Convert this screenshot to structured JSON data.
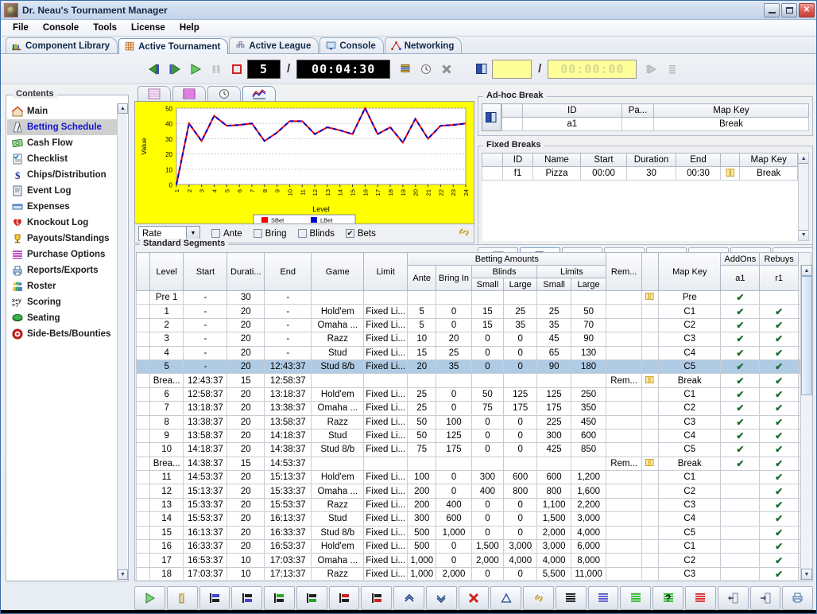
{
  "window": {
    "title": "Dr. Neau's Tournament Manager",
    "minimize_label": "Minimize",
    "maximize_label": "Maximize",
    "close_label": "✕"
  },
  "menu": [
    "File",
    "Console",
    "Tools",
    "License",
    "Help"
  ],
  "main_tabs": [
    {
      "label": "Component Library",
      "icon": "books-icon",
      "active": false
    },
    {
      "label": "Active Tournament",
      "icon": "grid-icon",
      "active": true
    },
    {
      "label": "Active League",
      "icon": "pyramid-icon",
      "active": false
    },
    {
      "label": "Console",
      "icon": "monitor-icon",
      "active": false
    },
    {
      "label": "Networking",
      "icon": "network-icon",
      "active": false
    }
  ],
  "transport": {
    "buttons": [
      "skip-to-start-icon",
      "step-forward-icon",
      "play-icon",
      "pause-icon",
      "stop-icon"
    ],
    "level_current": "5",
    "slash": "/",
    "clock": "00:04:30",
    "right_buttons": [
      "layers-icon",
      "clock-icon",
      "cancel-icon"
    ],
    "break_icon": "book-icon",
    "break_level": "",
    "break_clock": "00:00:00",
    "trailing_buttons": [
      "play-disabled-icon",
      "list-disabled-icon"
    ]
  },
  "sidebar": {
    "title": "Contents",
    "items": [
      {
        "label": "Main",
        "icon": "home-icon"
      },
      {
        "label": "Betting Schedule",
        "icon": "metronome-icon",
        "selected": true
      },
      {
        "label": "Cash Flow",
        "icon": "money-icon"
      },
      {
        "label": "Checklist",
        "icon": "checklist-icon"
      },
      {
        "label": "Chips/Distribution",
        "icon": "dollar-icon"
      },
      {
        "label": "Event Log",
        "icon": "log-icon"
      },
      {
        "label": "Expenses",
        "icon": "expenses-icon"
      },
      {
        "label": "Knockout Log",
        "icon": "broken-heart-icon"
      },
      {
        "label": "Payouts/Standings",
        "icon": "trophy-icon"
      },
      {
        "label": "Purchase Options",
        "icon": "stack-icon"
      },
      {
        "label": "Reports/Exports",
        "icon": "printer-icon"
      },
      {
        "label": "Roster",
        "icon": "people-icon"
      },
      {
        "label": "Scoring",
        "icon": "formula-icon"
      },
      {
        "label": "Seating",
        "icon": "table-icon"
      },
      {
        "label": "Side-Bets/Bounties",
        "icon": "target-icon"
      }
    ]
  },
  "chart_tabs": [
    {
      "icon": "table-pink-icon",
      "active": false
    },
    {
      "icon": "table-magenta-icon",
      "active": false
    },
    {
      "icon": "clock-icon",
      "active": false
    },
    {
      "icon": "chart-icon",
      "active": true
    }
  ],
  "chart_options": {
    "mode": "Rate",
    "checkboxes": [
      {
        "label": "Ante",
        "checked": false
      },
      {
        "label": "Bring",
        "checked": false
      },
      {
        "label": "Blinds",
        "checked": false
      },
      {
        "label": "Bets",
        "checked": true
      }
    ],
    "link_icon": "chain-icon"
  },
  "chart_data": {
    "type": "line",
    "title": "",
    "xlabel": "Level",
    "ylabel": "Value",
    "background": "#ffff00",
    "plot_background": "#ffffff",
    "grid": true,
    "legend_position": "bottom",
    "xlim": [
      1,
      24
    ],
    "ylim": [
      0,
      50
    ],
    "yticks": [
      0,
      10,
      20,
      30,
      40,
      50
    ],
    "categories": [
      1,
      2,
      3,
      4,
      5,
      6,
      7,
      8,
      9,
      10,
      11,
      12,
      13,
      14,
      15,
      16,
      17,
      18,
      19,
      20,
      21,
      22,
      23,
      24
    ],
    "series": [
      {
        "name": "SBet",
        "color": "#ff0000",
        "values": [
          0,
          40,
          28.5,
          45,
          38.5,
          39,
          40,
          28.5,
          34,
          41.5,
          41.5,
          33,
          37.5,
          35.5,
          33,
          50,
          33,
          37.5,
          27.5,
          43,
          30,
          38.5,
          39,
          40
        ]
      },
      {
        "name": "LBet",
        "color": "#0000cc",
        "values": [
          0,
          40,
          28.5,
          45,
          38.5,
          39,
          40,
          28.5,
          34,
          41.5,
          41.5,
          33,
          37.5,
          35.5,
          33,
          50,
          33,
          37.5,
          27.5,
          43,
          30,
          38.5,
          39,
          40
        ]
      }
    ]
  },
  "adhoc": {
    "title": "Ad-hoc Break",
    "icon": "book-icon",
    "headers": [
      "",
      "",
      "ID",
      "Pa...",
      "Map Key"
    ],
    "rows": [
      {
        "id": "a1",
        "pa": "",
        "map_key": "Break"
      }
    ]
  },
  "fixed_breaks": {
    "title": "Fixed Breaks",
    "headers": [
      "",
      "ID",
      "Name",
      "Start",
      "Duration",
      "End",
      "",
      "Map Key"
    ],
    "rows": [
      {
        "id": "f1",
        "name": "Pizza",
        "start": "00:00",
        "duration": "30",
        "end": "00:30",
        "flag": "pause-icon",
        "map_key": "Break"
      }
    ],
    "toolbar": [
      "book-disabled-icon",
      "new-doc-icon",
      "triangle-disabled-icon",
      "delete-disabled-icon",
      "red-lines-icon",
      "clock-disabled-icon",
      "percent-disabled-icon",
      "undo-disabled-icon"
    ]
  },
  "segments": {
    "title": "Standard Segments",
    "group_headers": {
      "betting": "Betting Amounts",
      "blinds": "Blinds",
      "limits": "Limits",
      "addons": "AddOns",
      "rebuys": "Rebuys"
    },
    "headers": [
      "",
      "Level",
      "Start",
      "Durati...",
      "End",
      "Game",
      "Limit",
      "Ante",
      "Bring In",
      "Small",
      "Large",
      "Small",
      "Large",
      "Rem...",
      "",
      "Map Key",
      "a1",
      "r1"
    ],
    "rows": [
      {
        "marker": "dark",
        "level": "Pre 1",
        "start": "-",
        "duration": "30",
        "end": "-",
        "game": "",
        "limit": "",
        "ante": "",
        "bring_in": "",
        "bs": "",
        "bl": "",
        "ls": "",
        "ll": "",
        "rem": "",
        "flag": "pause-icon",
        "map_key": "Pre",
        "addon": true,
        "rebuy": false,
        "shaded": true
      },
      {
        "marker": "dark",
        "level": "1",
        "start": "-",
        "duration": "20",
        "end": "-",
        "game": "Hold'em",
        "limit": "Fixed Li...",
        "ante": "5",
        "bring_in": "0",
        "bs": "15",
        "bl": "25",
        "ls": "25",
        "ll": "50",
        "rem": "",
        "flag": "",
        "map_key": "C1",
        "addon": true,
        "rebuy": true,
        "shaded": true
      },
      {
        "marker": "dark",
        "level": "2",
        "start": "-",
        "duration": "20",
        "end": "-",
        "game": "Omaha ...",
        "limit": "Fixed Li...",
        "ante": "5",
        "bring_in": "0",
        "bs": "15",
        "bl": "35",
        "ls": "35",
        "ll": "70",
        "rem": "",
        "flag": "",
        "map_key": "C2",
        "addon": true,
        "rebuy": true,
        "shaded": true
      },
      {
        "marker": "dark",
        "level": "3",
        "start": "-",
        "duration": "20",
        "end": "-",
        "game": "Razz",
        "limit": "Fixed Li...",
        "ante": "10",
        "bring_in": "20",
        "bs": "0",
        "bl": "0",
        "ls": "45",
        "ll": "90",
        "rem": "",
        "flag": "",
        "map_key": "C3",
        "addon": true,
        "rebuy": true,
        "shaded": true
      },
      {
        "marker": "dark",
        "level": "4",
        "start": "-",
        "duration": "20",
        "end": "-",
        "game": "Stud",
        "limit": "Fixed Li...",
        "ante": "15",
        "bring_in": "25",
        "bs": "0",
        "bl": "0",
        "ls": "65",
        "ll": "130",
        "rem": "",
        "flag": "",
        "map_key": "C4",
        "addon": true,
        "rebuy": true,
        "shaded": true
      },
      {
        "marker": "green",
        "level": "5",
        "start": "-",
        "duration": "20",
        "end": "12:43:37",
        "game": "Stud 8/b",
        "limit": "Fixed Li...",
        "ante": "20",
        "bring_in": "35",
        "bs": "0",
        "bl": "0",
        "ls": "90",
        "ll": "180",
        "rem": "",
        "flag": "",
        "map_key": "C5",
        "addon": true,
        "rebuy": true,
        "selected": true
      },
      {
        "marker": "blue",
        "level": "Brea...",
        "start": "12:43:37",
        "duration": "15",
        "end": "12:58:37",
        "game": "",
        "limit": "",
        "ante": "",
        "bring_in": "",
        "bs": "",
        "bl": "",
        "ls": "",
        "ll": "",
        "rem": "Rem...",
        "flag": "pause-icon",
        "map_key": "Break",
        "addon": true,
        "rebuy": true,
        "shaded": true
      },
      {
        "marker": "blue",
        "level": "6",
        "start": "12:58:37",
        "duration": "20",
        "end": "13:18:37",
        "game": "Hold'em",
        "limit": "Fixed Li...",
        "ante": "25",
        "bring_in": "0",
        "bs": "50",
        "bl": "125",
        "ls": "125",
        "ll": "250",
        "rem": "",
        "flag": "",
        "map_key": "C1",
        "addon": true,
        "rebuy": true,
        "shaded": true
      },
      {
        "marker": "blue",
        "level": "7",
        "start": "13:18:37",
        "duration": "20",
        "end": "13:38:37",
        "game": "Omaha ...",
        "limit": "Fixed Li...",
        "ante": "25",
        "bring_in": "0",
        "bs": "75",
        "bl": "175",
        "ls": "175",
        "ll": "350",
        "rem": "",
        "flag": "",
        "map_key": "C2",
        "addon": true,
        "rebuy": true,
        "shaded": true
      },
      {
        "marker": "blue",
        "level": "8",
        "start": "13:38:37",
        "duration": "20",
        "end": "13:58:37",
        "game": "Razz",
        "limit": "Fixed Li...",
        "ante": "50",
        "bring_in": "100",
        "bs": "0",
        "bl": "0",
        "ls": "225",
        "ll": "450",
        "rem": "",
        "flag": "",
        "map_key": "C3",
        "addon": true,
        "rebuy": true,
        "shaded": true
      },
      {
        "marker": "blue",
        "level": "9",
        "start": "13:58:37",
        "duration": "20",
        "end": "14:18:37",
        "game": "Stud",
        "limit": "Fixed Li...",
        "ante": "50",
        "bring_in": "125",
        "bs": "0",
        "bl": "0",
        "ls": "300",
        "ll": "600",
        "rem": "",
        "flag": "",
        "map_key": "C4",
        "addon": true,
        "rebuy": true,
        "shaded": true
      },
      {
        "marker": "blue",
        "level": "10",
        "start": "14:18:37",
        "duration": "20",
        "end": "14:38:37",
        "game": "Stud 8/b",
        "limit": "Fixed Li...",
        "ante": "75",
        "bring_in": "175",
        "bs": "0",
        "bl": "0",
        "ls": "425",
        "ll": "850",
        "rem": "",
        "flag": "",
        "map_key": "C5",
        "addon": true,
        "rebuy": true,
        "shaded": true
      },
      {
        "marker": "blue",
        "level": "Brea...",
        "start": "14:38:37",
        "duration": "15",
        "end": "14:53:37",
        "game": "",
        "limit": "",
        "ante": "",
        "bring_in": "",
        "bs": "",
        "bl": "",
        "ls": "",
        "ll": "",
        "rem": "Rem...",
        "flag": "pause-icon",
        "map_key": "Break",
        "addon": true,
        "rebuy": true,
        "shaded": true
      },
      {
        "marker": "blue",
        "level": "11",
        "start": "14:53:37",
        "duration": "20",
        "end": "15:13:37",
        "game": "Hold'em",
        "limit": "Fixed Li...",
        "ante": "100",
        "bring_in": "0",
        "bs": "300",
        "bl": "600",
        "ls": "600",
        "ll": "1,200",
        "rem": "",
        "flag": "",
        "map_key": "C1",
        "addon": false,
        "rebuy": true,
        "shaded": true
      },
      {
        "marker": "blue",
        "level": "12",
        "start": "15:13:37",
        "duration": "20",
        "end": "15:33:37",
        "game": "Omaha ...",
        "limit": "Fixed Li...",
        "ante": "200",
        "bring_in": "0",
        "bs": "400",
        "bl": "800",
        "ls": "800",
        "ll": "1,600",
        "rem": "",
        "flag": "",
        "map_key": "C2",
        "addon": false,
        "rebuy": true,
        "shaded": true
      },
      {
        "marker": "blue",
        "level": "13",
        "start": "15:33:37",
        "duration": "20",
        "end": "15:53:37",
        "game": "Razz",
        "limit": "Fixed Li...",
        "ante": "200",
        "bring_in": "400",
        "bs": "0",
        "bl": "0",
        "ls": "1,100",
        "ll": "2,200",
        "rem": "",
        "flag": "",
        "map_key": "C3",
        "addon": false,
        "rebuy": true,
        "shaded": true
      },
      {
        "marker": "blue",
        "level": "14",
        "start": "15:53:37",
        "duration": "20",
        "end": "16:13:37",
        "game": "Stud",
        "limit": "Fixed Li...",
        "ante": "300",
        "bring_in": "600",
        "bs": "0",
        "bl": "0",
        "ls": "1,500",
        "ll": "3,000",
        "rem": "",
        "flag": "",
        "map_key": "C4",
        "addon": false,
        "rebuy": true,
        "shaded": true
      },
      {
        "marker": "blue",
        "level": "15",
        "start": "16:13:37",
        "duration": "20",
        "end": "16:33:37",
        "game": "Stud 8/b",
        "limit": "Fixed Li...",
        "ante": "500",
        "bring_in": "1,000",
        "bs": "0",
        "bl": "0",
        "ls": "2,000",
        "ll": "4,000",
        "rem": "",
        "flag": "",
        "map_key": "C5",
        "addon": false,
        "rebuy": true,
        "shaded": true
      },
      {
        "marker": "blue",
        "level": "16",
        "start": "16:33:37",
        "duration": "20",
        "end": "16:53:37",
        "game": "Hold'em",
        "limit": "Fixed Li...",
        "ante": "500",
        "bring_in": "0",
        "bs": "1,500",
        "bl": "3,000",
        "ls": "3,000",
        "ll": "6,000",
        "rem": "",
        "flag": "",
        "map_key": "C1",
        "addon": false,
        "rebuy": true,
        "shaded": true
      },
      {
        "marker": "blue",
        "level": "17",
        "start": "16:53:37",
        "duration": "10",
        "end": "17:03:37",
        "game": "Omaha ...",
        "limit": "Fixed Li...",
        "ante": "1,000",
        "bring_in": "0",
        "bs": "2,000",
        "bl": "4,000",
        "ls": "4,000",
        "ll": "8,000",
        "rem": "",
        "flag": "",
        "map_key": "C2",
        "addon": false,
        "rebuy": true,
        "shaded": true
      },
      {
        "marker": "blue",
        "level": "18",
        "start": "17:03:37",
        "duration": "10",
        "end": "17:13:37",
        "game": "Razz",
        "limit": "Fixed Li...",
        "ante": "1,000",
        "bring_in": "2,000",
        "bs": "0",
        "bl": "0",
        "ls": "5,500",
        "ll": "11,000",
        "rem": "",
        "flag": "",
        "map_key": "C3",
        "addon": false,
        "rebuy": true,
        "shaded": true
      }
    ]
  },
  "bottom_toolbar": [
    "play-green-icon",
    "wand-icon",
    "insert-blue-before-icon",
    "insert-blue-after-icon",
    "insert-green-before-icon",
    "insert-green-after-icon",
    "insert-red-before-icon",
    "insert-red-after-icon",
    "move-up-icon",
    "move-down-icon",
    "delete-red-icon",
    "triangle-blue-icon",
    "chain-icon",
    "black-lines-icon",
    "blue-lines-icon",
    "green-lines-icon",
    "question-lines-icon",
    "red-lines-icon",
    "import-icon",
    "export-icon",
    "print-icon"
  ]
}
